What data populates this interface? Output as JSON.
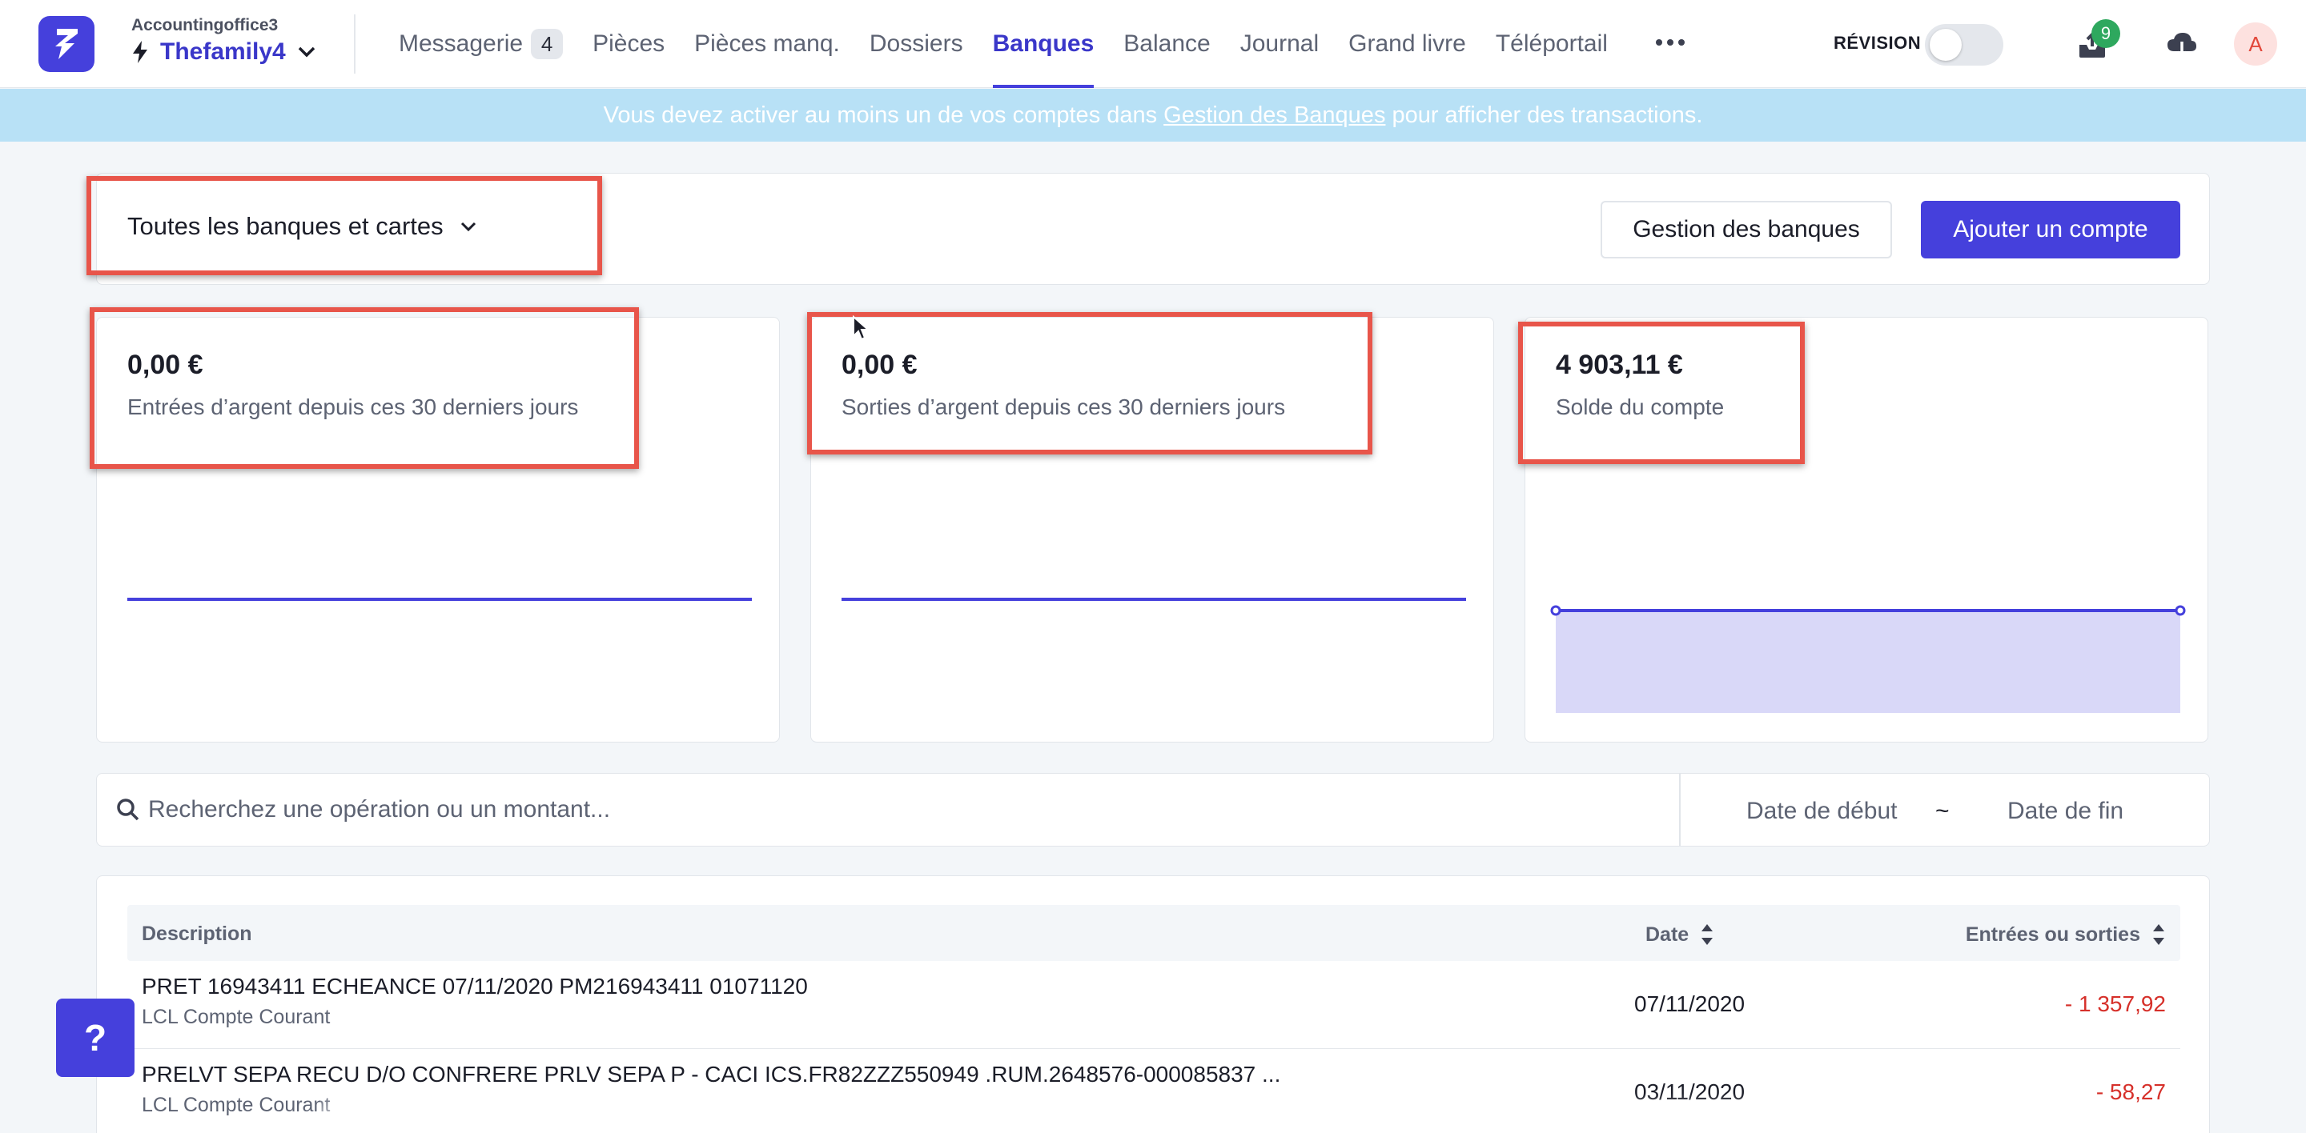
{
  "header": {
    "office_name": "Accountingoffice3",
    "company_name": "Thefamily4",
    "nav_tabs": [
      {
        "label": "Messagerie",
        "badge": "4"
      },
      {
        "label": "Pièces"
      },
      {
        "label": "Pièces manq."
      },
      {
        "label": "Dossiers"
      },
      {
        "label": "Banques",
        "active": true
      },
      {
        "label": "Balance"
      },
      {
        "label": "Journal"
      },
      {
        "label": "Grand livre"
      },
      {
        "label": "Téléportail"
      }
    ],
    "revision_label": "RÉVISION",
    "revision_on": false,
    "notifications_count": "9",
    "avatar_initial": "A"
  },
  "banner": {
    "text_before": "Vous devez activer au moins un de vos comptes dans",
    "link_text": "Gestion des Banques",
    "text_after": "pour afficher des transactions."
  },
  "filter": {
    "bank_select": "Toutes les banques et cartes",
    "manage_button": "Gestion des banques",
    "add_button": "Ajouter un compte"
  },
  "stats": [
    {
      "amount": "0,00 €",
      "label": "Entrées d’argent depuis ces 30 derniers jours",
      "chart": "line"
    },
    {
      "amount": "0,00 €",
      "label": "Sorties d’argent depuis ces 30 derniers jours",
      "chart": "line"
    },
    {
      "amount": "4 903,11 €",
      "label": "Solde du compte",
      "chart": "area"
    }
  ],
  "search": {
    "placeholder": "Recherchez une opération ou un montant...",
    "date_start": "Date de début",
    "date_separator": "~",
    "date_end": "Date de fin"
  },
  "table": {
    "columns": [
      "Description",
      "Date",
      "Entrées ou sorties"
    ],
    "rows": [
      {
        "description": "PRET 16943411 ECHEANCE 07/11/2020 PM216943411 01071120",
        "bank": "LCL Compte Courant",
        "date": "07/11/2020",
        "amount": "- 1 357,92"
      },
      {
        "description": "PRELVT SEPA RECU D/O CONFRERE PRLV SEPA P - CACI ICS.FR82ZZZ550949 .RUM.2648576-000085837 ...",
        "bank": "LCL Compte Courant",
        "date": "03/11/2020",
        "amount": "- 58,27"
      }
    ]
  },
  "help_label": "?",
  "colors": {
    "accent": "#4540dc",
    "banner": "#b8e1f6",
    "negative": "#d6302a",
    "highlight": "#e8554a",
    "badge_green": "#2ea85e"
  }
}
